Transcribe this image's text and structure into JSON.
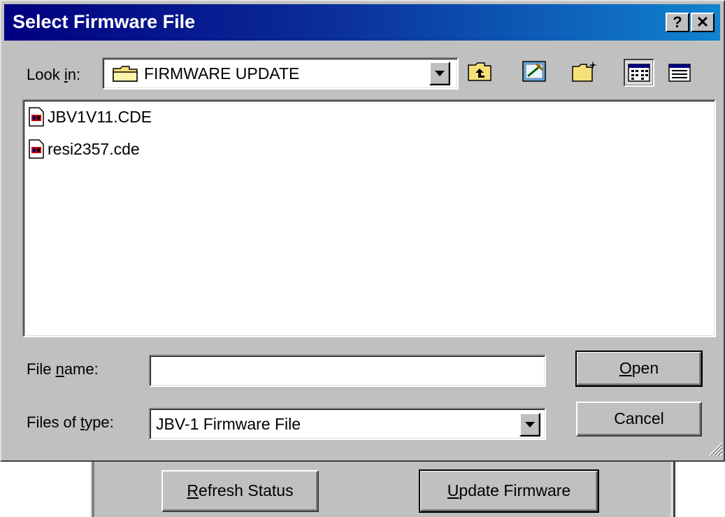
{
  "dialog": {
    "title": "Select Firmware File",
    "help_button": "?",
    "close_button": "✕",
    "look_in_label": "Look in:",
    "look_in_value": "FIRMWARE UPDATE",
    "files": [
      {
        "name": "JBV1V11.CDE"
      },
      {
        "name": "resi2357.cde"
      }
    ],
    "file_name_label": "File name:",
    "file_name_value": "",
    "files_of_type_label": "Files of type:",
    "files_of_type_value": "JBV-1 Firmware File",
    "open_label": "Open",
    "cancel_label": "Cancel"
  },
  "background_window": {
    "refresh_label": "Refresh Status",
    "update_label": "Update Firmware"
  },
  "icons": [
    "folder-icon",
    "up-folder-icon",
    "desktop-icon",
    "new-folder-icon",
    "list-view-icon",
    "details-view-icon",
    "file-icon"
  ],
  "colors": {
    "titlebar_start": "#000080",
    "titlebar_end": "#1084d0",
    "face": "#c0c0c0"
  }
}
